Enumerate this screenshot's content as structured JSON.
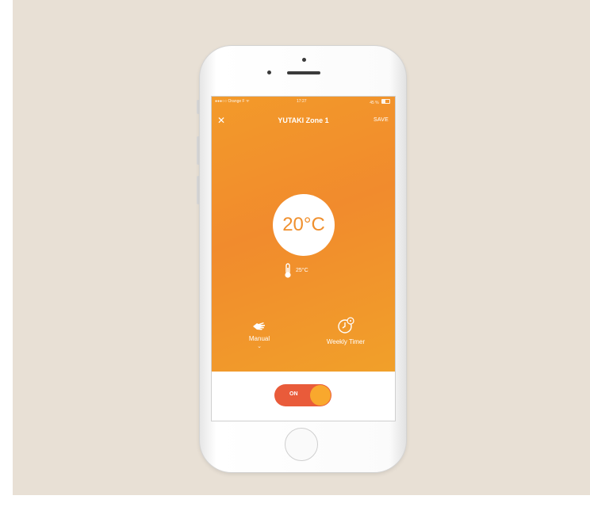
{
  "status_bar": {
    "carrier": "●●●○○ Orange F ᯤ",
    "time": "17:27",
    "battery": "45 %"
  },
  "header": {
    "close_icon": "close-icon",
    "title": "YUTAKI Zone 1",
    "save_label": "SAVE"
  },
  "setpoint": {
    "value": "20°C"
  },
  "sensor": {
    "icon": "thermometer-icon",
    "value": "25°C"
  },
  "modes": [
    {
      "label": "Manual",
      "icon": "hand-icon",
      "chevron": "⌄"
    },
    {
      "label": "Weekly Timer",
      "icon": "clock-icon"
    }
  ],
  "power": {
    "label": "ON",
    "state": true
  },
  "colors": {
    "orange_top": "#f39a2a",
    "orange_bottom": "#f1a02a",
    "toggle_track": "#e95b3a",
    "toggle_knob": "#f9a82d",
    "backdrop": "#e8e0d5"
  }
}
